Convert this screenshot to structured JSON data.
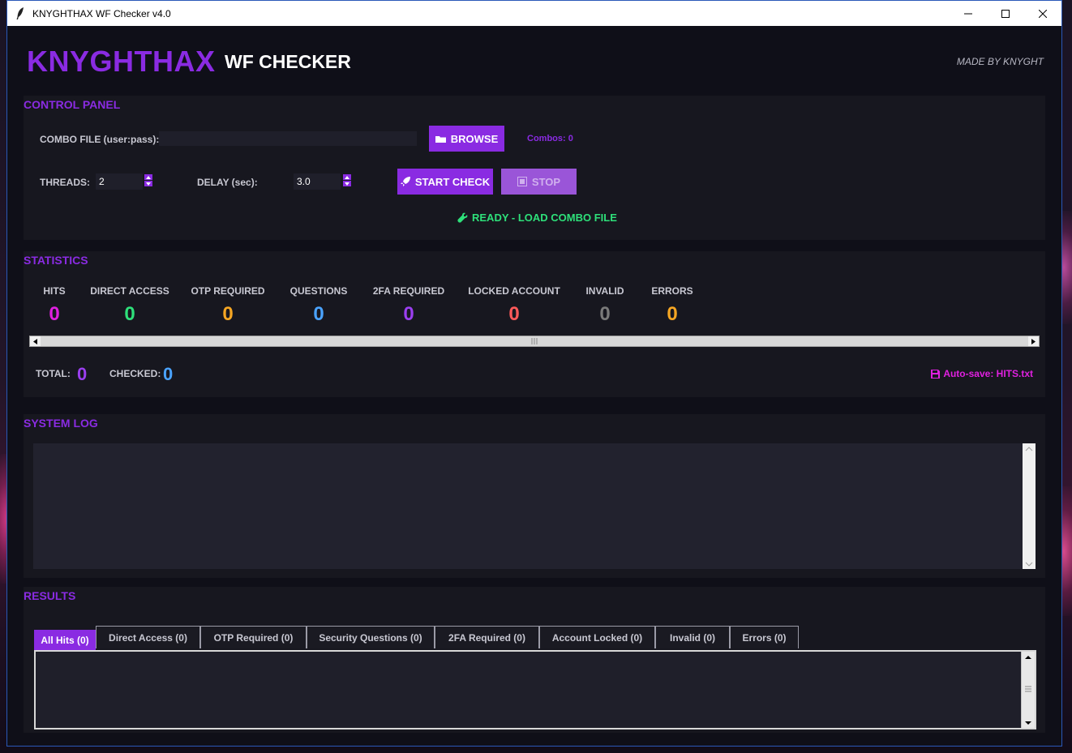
{
  "window": {
    "title": "KNYGHTHAX WF Checker v4.0"
  },
  "header": {
    "brand": "KNYGHTHAX",
    "subtitle": "WF CHECKER",
    "credit": "MADE BY KNYGHT"
  },
  "control_panel": {
    "title": "CONTROL PANEL",
    "combo_label": "COMBO FILE (user:pass):",
    "combo_value": "",
    "browse_label": "BROWSE",
    "combos_count": "Combos: 0",
    "threads_label": "THREADS:",
    "threads_value": "2",
    "delay_label": "DELAY (sec):",
    "delay_value": "3.0",
    "start_label": "START CHECK",
    "stop_label": "STOP",
    "status": "READY - LOAD COMBO FILE"
  },
  "statistics": {
    "title": "STATISTICS",
    "items": [
      {
        "label": "HITS",
        "value": "0",
        "color": "#e020e0"
      },
      {
        "label": "DIRECT ACCESS",
        "value": "0",
        "color": "#2ee07a"
      },
      {
        "label": "OTP REQUIRED",
        "value": "0",
        "color": "#f5a623"
      },
      {
        "label": "QUESTIONS",
        "value": "0",
        "color": "#4aa3ff"
      },
      {
        "label": "2FA REQUIRED",
        "value": "0",
        "color": "#9b3ff0"
      },
      {
        "label": "LOCKED ACCOUNT",
        "value": "0",
        "color": "#ff5a5a"
      },
      {
        "label": "INVALID",
        "value": "0",
        "color": "#7a7a7a"
      },
      {
        "label": "ERRORS",
        "value": "0",
        "color": "#f5a623"
      }
    ],
    "total_label": "TOTAL:",
    "total_value": "0",
    "checked_label": "CHECKED:",
    "checked_value": "0",
    "autosave": "Auto-save: HITS.txt"
  },
  "system_log": {
    "title": "SYSTEM LOG"
  },
  "results": {
    "title": "RESULTS",
    "tabs": [
      {
        "label": "All Hits (0)"
      },
      {
        "label": "Direct Access (0)"
      },
      {
        "label": "OTP Required (0)"
      },
      {
        "label": "Security Questions (0)"
      },
      {
        "label": "2FA Required (0)"
      },
      {
        "label": "Account Locked (0)"
      },
      {
        "label": "Invalid (0)"
      },
      {
        "label": "Errors (0)"
      }
    ]
  },
  "colors": {
    "accent": "#8a2be2",
    "status_green": "#2ee07a",
    "autosave_pink": "#e020e0"
  }
}
